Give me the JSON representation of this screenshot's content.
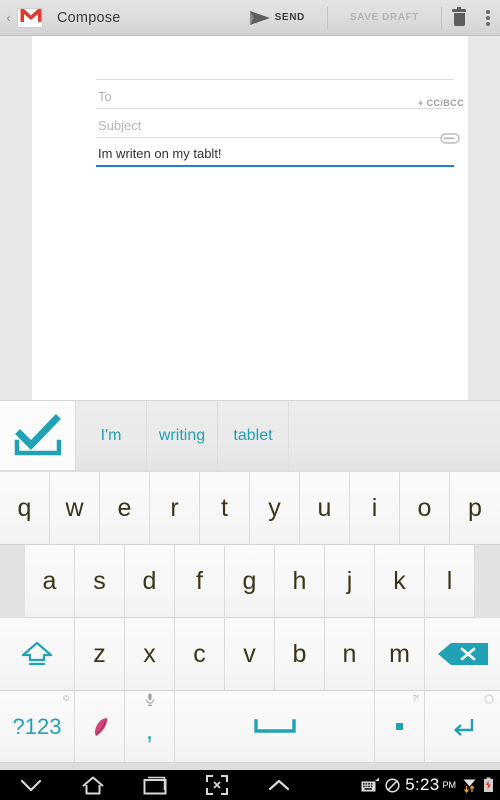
{
  "actionbar": {
    "up_label": "‹",
    "app_icon_name": "gmail-envelope-icon",
    "title": "Compose",
    "send_label": "SEND",
    "save_draft_label": "SAVE DRAFT",
    "delete_icon_name": "trash-icon",
    "overflow_icon_name": "overflow-menu-icon"
  },
  "compose": {
    "from_value": "",
    "to_placeholder": "To",
    "to_value": "",
    "subject_placeholder": "Subject",
    "subject_value": "",
    "body_value": "Im writen on my tablt!",
    "cc_bcc_label": "+ CC/BCC",
    "attach_icon_name": "paperclip-icon",
    "focus_color": "#1f7fd0"
  },
  "suggestions": {
    "confirm_icon_name": "checkmark-icon",
    "accent_color": "#21a2b4",
    "words": [
      "I'm",
      "writing",
      "tablet"
    ]
  },
  "keyboard": {
    "row1": [
      "q",
      "w",
      "e",
      "r",
      "t",
      "y",
      "u",
      "i",
      "o",
      "p"
    ],
    "row2": [
      "a",
      "s",
      "d",
      "f",
      "g",
      "h",
      "j",
      "k",
      "l"
    ],
    "row3": [
      "z",
      "x",
      "c",
      "v",
      "b",
      "n",
      "m"
    ],
    "shift_icon_name": "shift-arrow-icon",
    "backspace_icon_name": "backspace-icon",
    "symbols_label": "?123",
    "symbols_hint": "©",
    "feather_icon_name": "feather-pen-icon",
    "comma_label": ",",
    "comma_hint_icon_name": "microphone-icon",
    "space_icon_name": "spacebar-icon",
    "period_label": ".",
    "period_hint": "?!",
    "enter_icon_name": "enter-return-icon",
    "key_text_color": "#3a3518",
    "accent_color": "#21a2b4"
  },
  "navbar": {
    "back_icon_name": "back-chevron-down-icon",
    "home_icon_name": "home-icon",
    "recents_icon_name": "recent-apps-icon",
    "screenshot_icon_name": "screenshot-icon",
    "expand_icon_name": "expand-chevron-up-icon",
    "keyboard_status_icon_name": "keyboard-status-icon",
    "mute_icon_name": "mute-icon",
    "time": "5:23",
    "meridiem": "PM",
    "wifi_icon_name": "wifi-icon",
    "battery_icon_name": "battery-low-icon"
  }
}
